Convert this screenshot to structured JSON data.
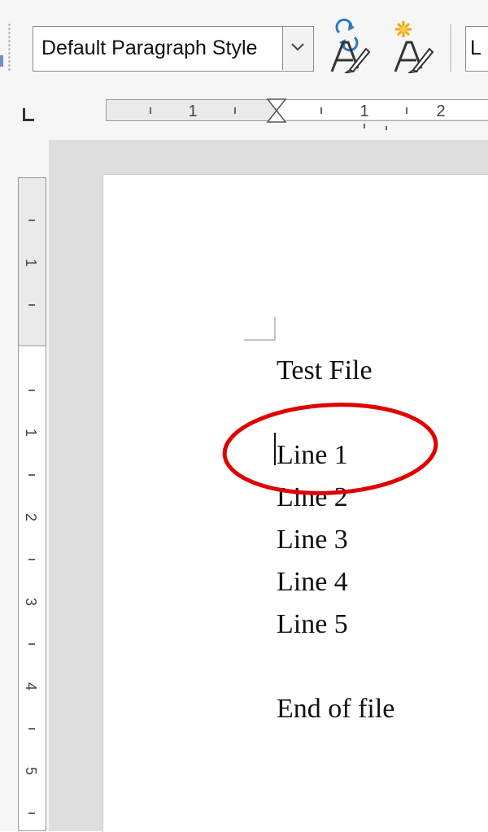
{
  "toolbar": {
    "paragraph_style": {
      "value": "Default Paragraph Style"
    },
    "font_name": {
      "value": "L"
    },
    "icons": [
      "update-style-icon",
      "new-style-icon",
      "chevron-down-icon"
    ]
  },
  "horizontal_ruler": {
    "labels": [
      "1",
      "1",
      "2"
    ]
  },
  "vertical_ruler": {
    "labels": [
      "1",
      "1",
      "2",
      "3",
      "4",
      "5"
    ]
  },
  "document": {
    "lines": [
      "Test File",
      "",
      "Line 1",
      "Line 2",
      "Line 3",
      "Line 4",
      "Line 5",
      "",
      "End of file"
    ]
  },
  "colors": {
    "annotation_ellipse": "#e00000",
    "ruler_margin": "#eaeaea",
    "workspace": "#dedede",
    "style_icon_blue": "#2f78c4",
    "new_style_star": "#f0a800"
  }
}
